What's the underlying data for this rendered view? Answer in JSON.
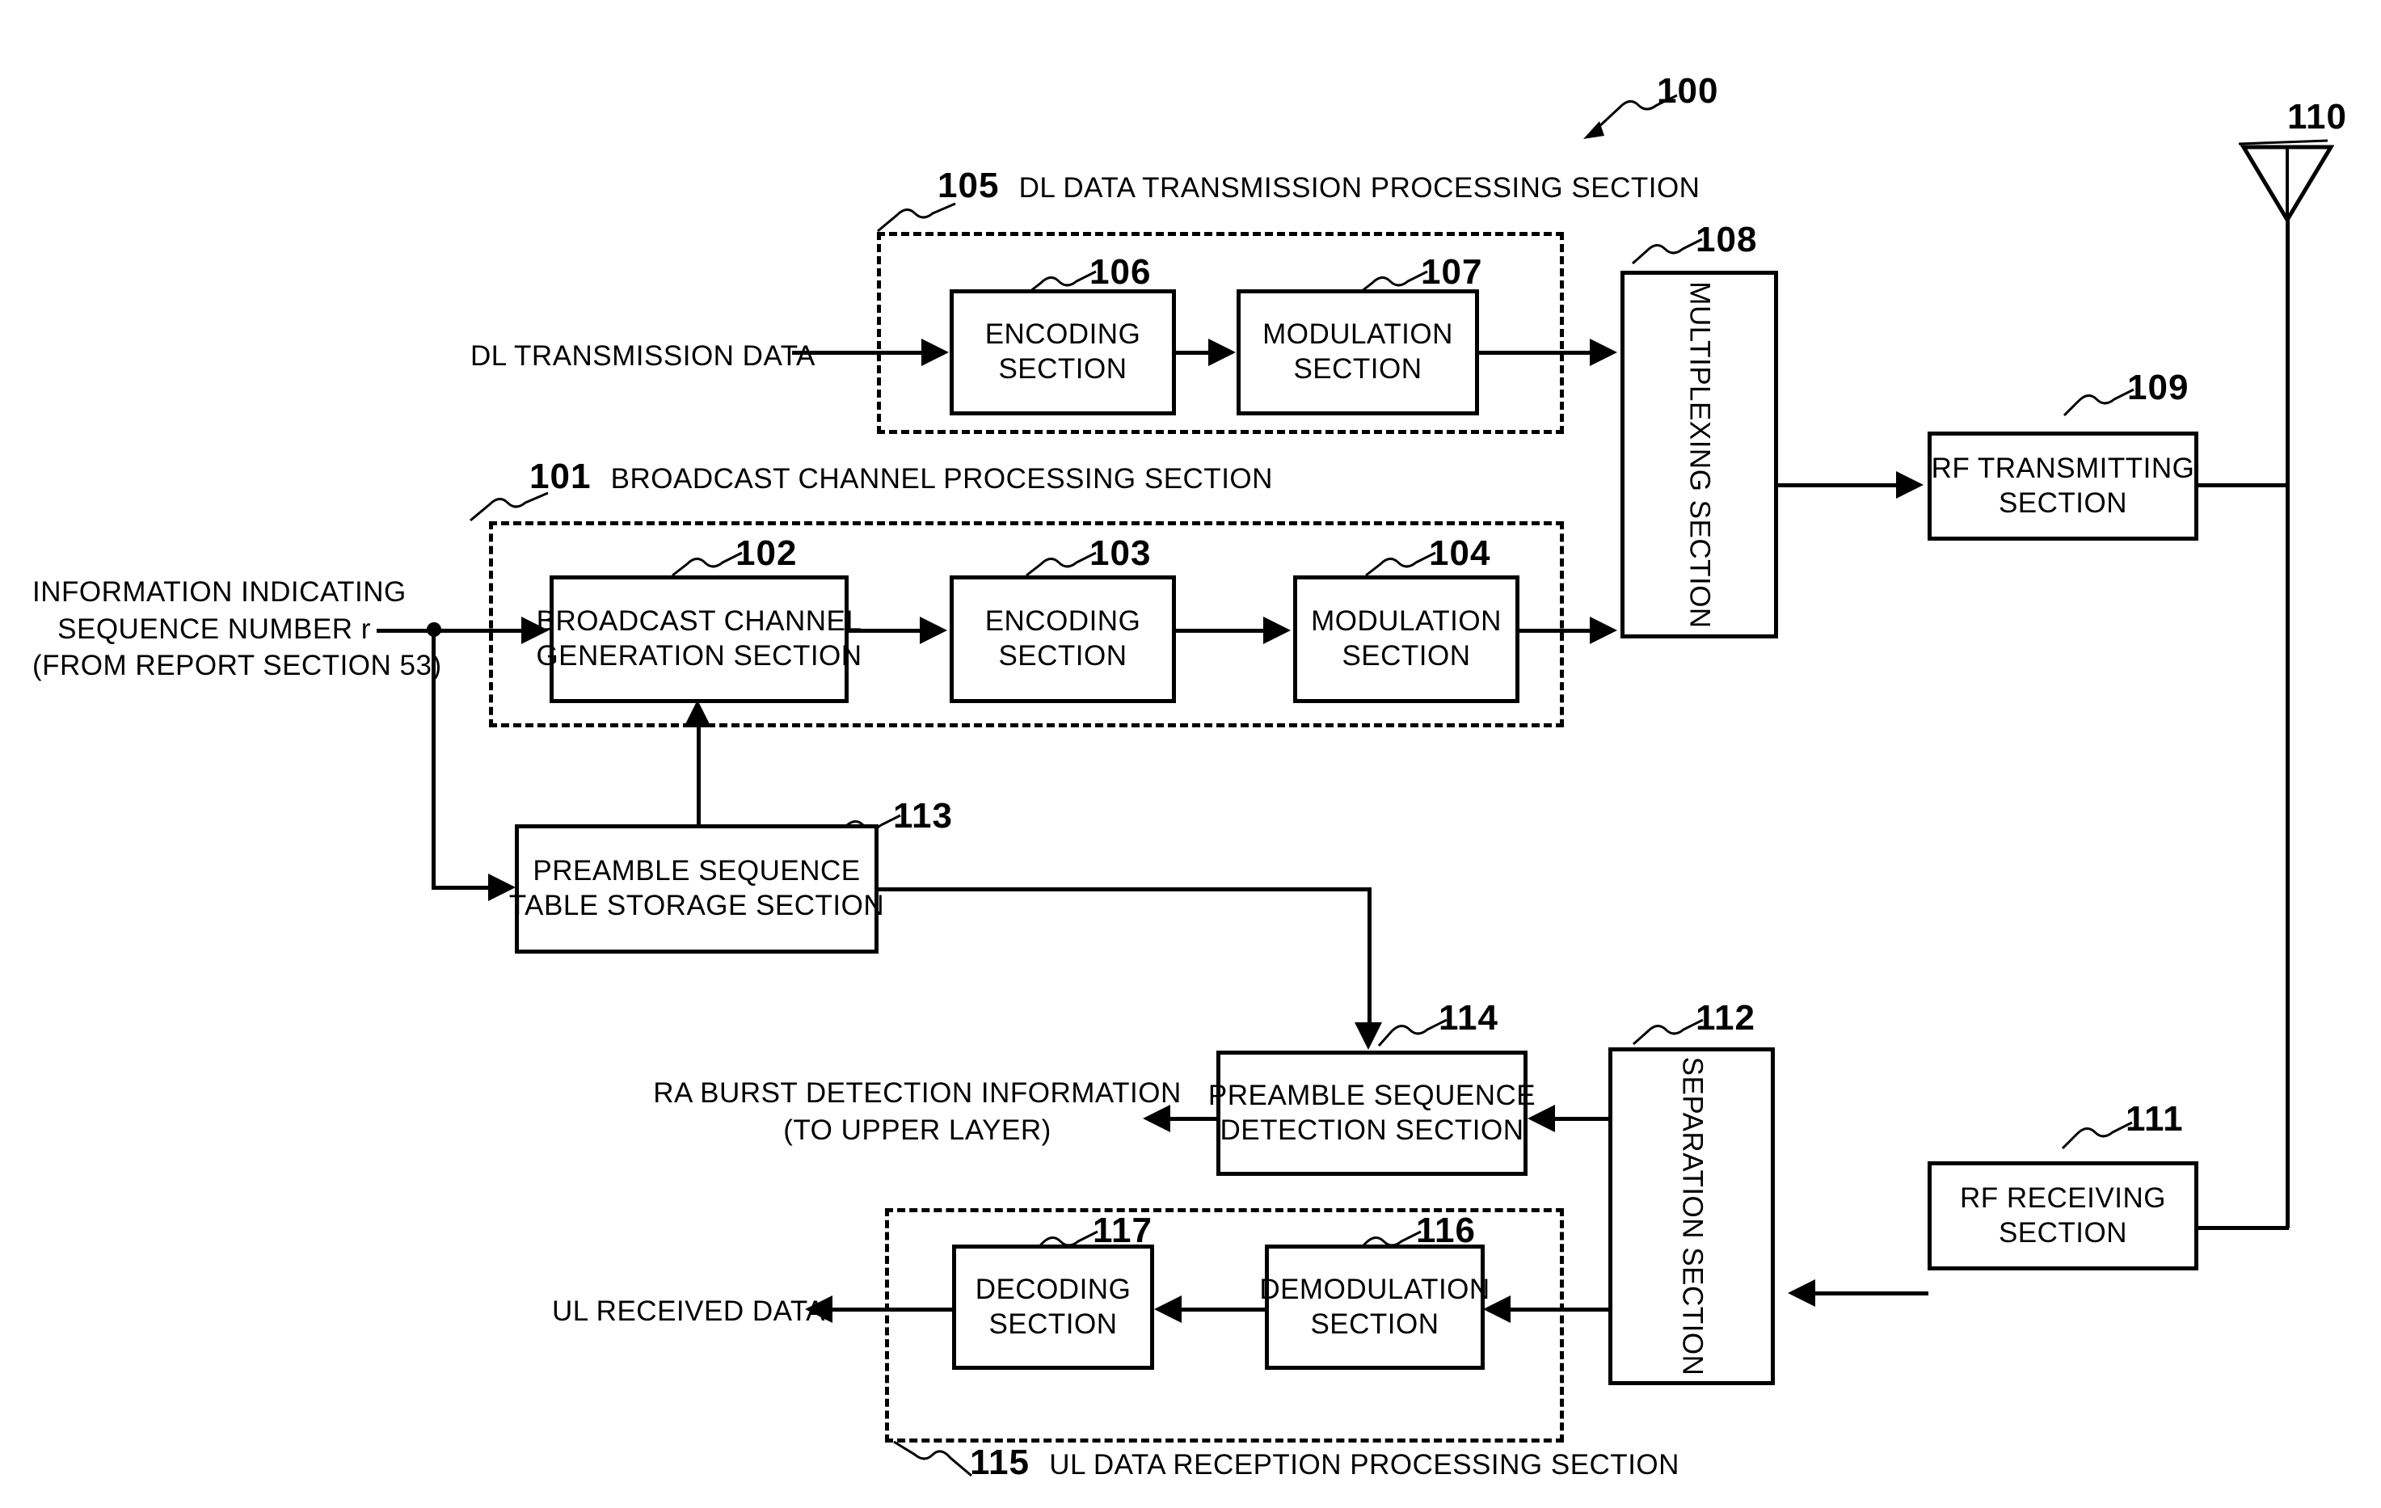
{
  "figure": {
    "device_number": "100",
    "antenna_number": "110"
  },
  "groups": {
    "dl_tx": {
      "number": "105",
      "label": "DL DATA TRANSMISSION PROCESSING SECTION"
    },
    "bch": {
      "number": "101",
      "label": "BROADCAST CHANNEL PROCESSING SECTION"
    },
    "ul_rx": {
      "number": "115",
      "label": "UL DATA RECEPTION PROCESSING SECTION"
    }
  },
  "blocks": {
    "encoding_dl": {
      "number": "106",
      "line1": "ENCODING",
      "line2": "SECTION"
    },
    "modulation_dl": {
      "number": "107",
      "line1": "MODULATION",
      "line2": "SECTION"
    },
    "bch_generation": {
      "number": "102",
      "line1": "BROADCAST CHANNEL",
      "line2": "GENERATION SECTION"
    },
    "encoding_bch": {
      "number": "103",
      "line1": "ENCODING",
      "line2": "SECTION"
    },
    "modulation_bch": {
      "number": "104",
      "line1": "MODULATION",
      "line2": "SECTION"
    },
    "multiplexing": {
      "number": "108",
      "label": "MULTIPLEXING SECTION"
    },
    "rf_transmitting": {
      "number": "109",
      "line1": "RF TRANSMITTING",
      "line2": "SECTION"
    },
    "rf_receiving": {
      "number": "111",
      "line1": "RF RECEIVING",
      "line2": "SECTION"
    },
    "separation": {
      "number": "112",
      "label": "SEPARATION SECTION"
    },
    "preamble_table": {
      "number": "113",
      "line1": "PREAMBLE SEQUENCE",
      "line2": "TABLE STORAGE SECTION"
    },
    "preamble_detect": {
      "number": "114",
      "line1": "PREAMBLE SEQUENCE",
      "line2": "DETECTION SECTION"
    },
    "demodulation_ul": {
      "number": "116",
      "line1": "DEMODULATION",
      "line2": "SECTION"
    },
    "decoding_ul": {
      "number": "117",
      "line1": "DECODING",
      "line2": "SECTION"
    }
  },
  "io_labels": {
    "dl_transmission_data": "DL TRANSMISSION DATA",
    "sequence_info_line1": "INFORMATION INDICATING",
    "sequence_info_line2": "SEQUENCE NUMBER r",
    "sequence_info_line3": "(FROM REPORT SECTION 53)",
    "ra_burst_line1": "RA BURST DETECTION INFORMATION",
    "ra_burst_line2": "(TO UPPER LAYER)",
    "ul_received_data": "UL RECEIVED DATA"
  },
  "colors": {
    "stroke": "#000000",
    "background": "#ffffff"
  }
}
